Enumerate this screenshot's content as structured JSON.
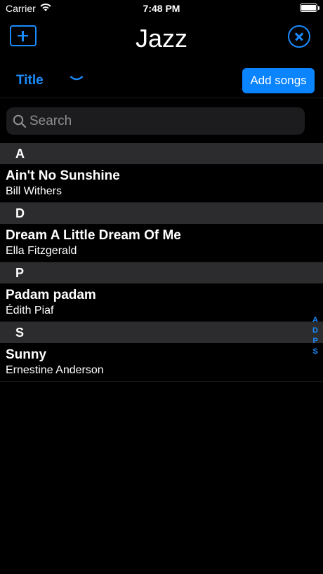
{
  "status_bar": {
    "carrier": "Carrier",
    "time": "7:48 PM"
  },
  "nav": {
    "title": "Jazz"
  },
  "toolbar": {
    "sort_label": "Title",
    "add_songs_label": "Add songs"
  },
  "search": {
    "placeholder": "Search",
    "value": ""
  },
  "sections": [
    {
      "letter": "A",
      "songs": [
        {
          "title": "Ain't No Sunshine",
          "artist": "Bill Withers"
        }
      ]
    },
    {
      "letter": "D",
      "songs": [
        {
          "title": "Dream A Little Dream Of Me",
          "artist": "Ella Fitzgerald"
        }
      ]
    },
    {
      "letter": "P",
      "songs": [
        {
          "title": "Padam padam",
          "artist": "Édith Piaf"
        }
      ]
    },
    {
      "letter": "S",
      "songs": [
        {
          "title": "Sunny",
          "artist": "Ernestine Anderson"
        }
      ]
    }
  ],
  "index": [
    "A",
    "D",
    "P",
    "S"
  ],
  "colors": {
    "accent": "#1a8cff",
    "button": "#0a84ff",
    "section_bg": "#2c2c2e",
    "search_bg": "#1c1c1e"
  }
}
